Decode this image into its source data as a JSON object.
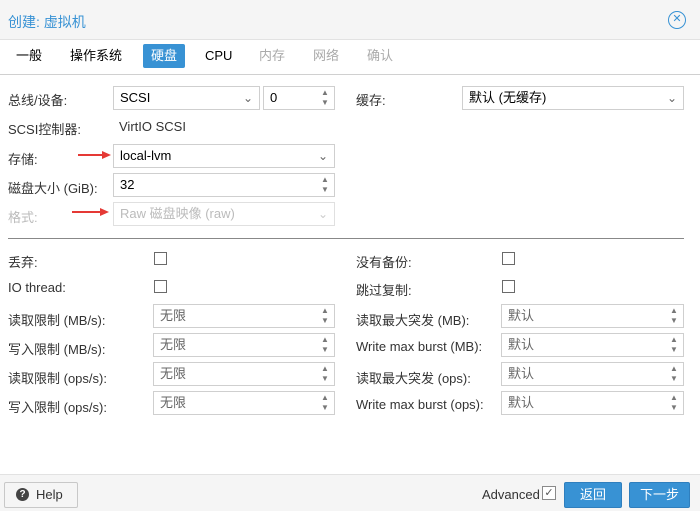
{
  "window": {
    "title": "创建: 虚拟机"
  },
  "tabs": [
    {
      "label": "一般",
      "state": "normal"
    },
    {
      "label": "操作系统",
      "state": "normal"
    },
    {
      "label": "硬盘",
      "state": "active"
    },
    {
      "label": "CPU",
      "state": "normal"
    },
    {
      "label": "内存",
      "state": "disabled"
    },
    {
      "label": "网络",
      "state": "disabled"
    },
    {
      "label": "确认",
      "state": "disabled"
    }
  ],
  "disk": {
    "bus_label": "总线/设备:",
    "bus_value": "SCSI",
    "device_value": "0",
    "controller_label": "SCSI控制器:",
    "controller_value": "VirtIO SCSI",
    "storage_label": "存储:",
    "storage_value": "local-lvm",
    "size_label": "磁盘大小 (GiB):",
    "size_value": "32",
    "format_label": "格式:",
    "format_value": "Raw 磁盘映像 (raw)",
    "cache_label": "缓存:",
    "cache_value": "默认 (无缓存)"
  },
  "options": {
    "discard_label": "丢弃:",
    "discard_checked": false,
    "iothread_label": "IO thread:",
    "iothread_checked": false,
    "nobackup_label": "没有备份:",
    "nobackup_checked": false,
    "skip_replication_label": "跳过复制:",
    "skip_replication_checked": false
  },
  "limits": {
    "read_mbs_label": "读取限制 (MB/s):",
    "read_mbs_value": "无限",
    "write_mbs_label": "写入限制 (MB/s):",
    "write_mbs_value": "无限",
    "read_ops_label": "读取限制 (ops/s):",
    "read_ops_value": "无限",
    "write_ops_label": "写入限制 (ops/s):",
    "write_ops_value": "无限",
    "read_burst_mb_label": "读取最大突发 (MB):",
    "read_burst_mb_value": "默认",
    "write_burst_mb_label": "Write max burst (MB):",
    "write_burst_mb_value": "默认",
    "read_burst_ops_label": "读取最大突发 (ops):",
    "read_burst_ops_value": "默认",
    "write_burst_ops_label": "Write max burst (ops):",
    "write_burst_ops_value": "默认"
  },
  "footer": {
    "help_label": "Help",
    "advanced_label": "Advanced",
    "advanced_checked": true,
    "back_label": "返回",
    "next_label": "下一步"
  },
  "colors": {
    "accent": "#3892d4",
    "arrow": "#e53935"
  },
  "icons": [
    "close-icon",
    "help-icon",
    "chevron-down-icon",
    "spinner-icon",
    "check-icon",
    "arrow-icon"
  ]
}
